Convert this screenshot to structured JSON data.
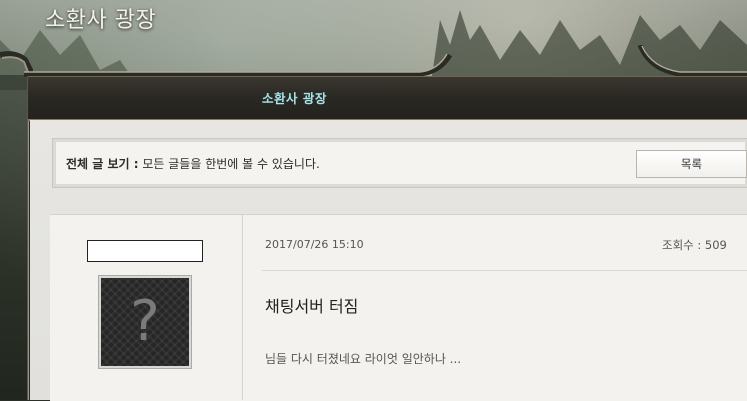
{
  "page": {
    "title": "소환사 광장"
  },
  "header": {
    "title": "소환사 광장"
  },
  "notice": {
    "label": "전체 글 보기 :",
    "text": "모든 글들을 한번에 볼 수 있습니다.",
    "list_button": "목록"
  },
  "post": {
    "author_name": "",
    "date": "2017/07/26 15:10",
    "views": "조회수 : 509",
    "title": "채팅서버 터짐",
    "preview": "님들 다시 터졌네요 라이엇 일안하나 ...",
    "avatar_icon": "question-mark-avatar-icon"
  },
  "colors": {
    "header_title": "#a6e4ea",
    "frame_gold": "#8a7c5c"
  }
}
